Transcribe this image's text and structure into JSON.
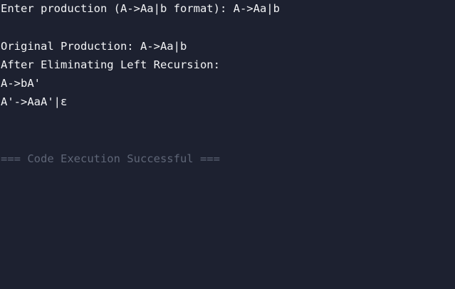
{
  "console": {
    "prompt": "Enter production (A->Aa|b format): A->Aa|b",
    "original": "Original Production: A->Aa|b",
    "heading": "After Eliminating Left Recursion:",
    "result1": "A->bA'",
    "result2": "A'->AaA'|ε",
    "status": "=== Code Execution Successful ==="
  },
  "colors": {
    "background": "#1d2130",
    "text": "#f3f4f6",
    "status": "#5f6677"
  }
}
